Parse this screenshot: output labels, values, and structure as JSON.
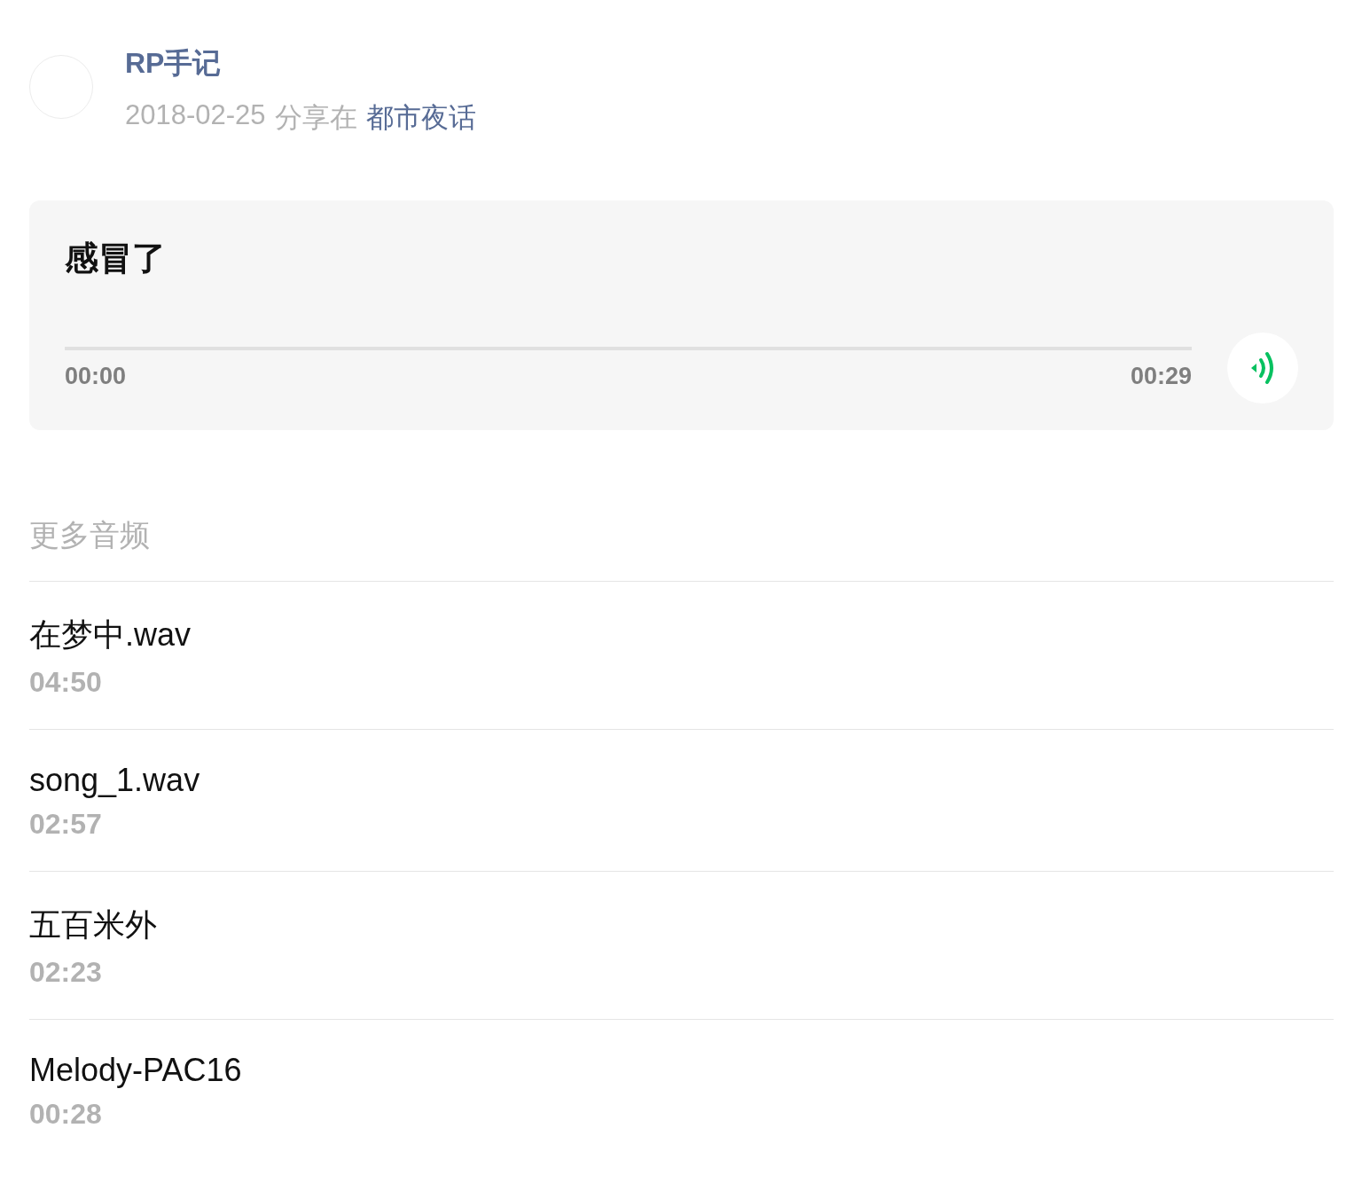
{
  "author": {
    "name": "RP手记",
    "date": "2018-02-25",
    "shared_label": "分享在",
    "channel": "都市夜话"
  },
  "player": {
    "title": "感冒了",
    "level": 0,
    "elapsed": "00:00",
    "duration": "00:29"
  },
  "more": {
    "heading": "更多音频",
    "items": [
      {
        "title": "在梦中.wav",
        "duration": "04:50"
      },
      {
        "title": "song_1.wav",
        "duration": "02:57"
      },
      {
        "title": "五百米外",
        "duration": "02:23"
      },
      {
        "title": "Melody-PAC16",
        "duration": "00:28"
      }
    ]
  }
}
